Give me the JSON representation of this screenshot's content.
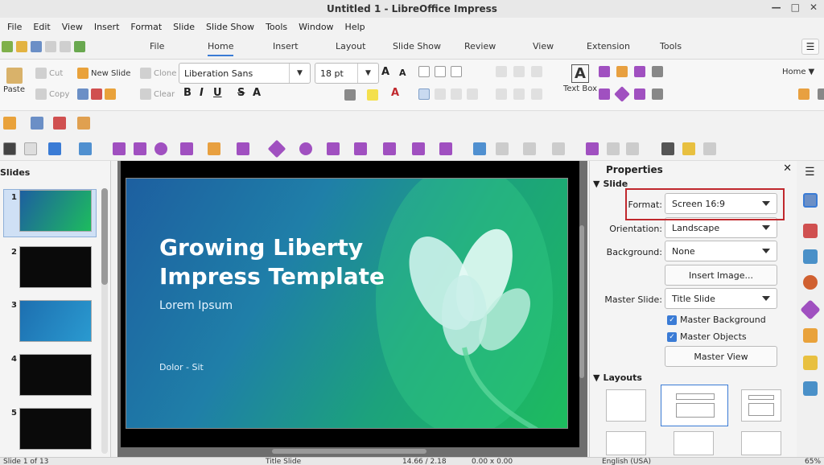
{
  "window": {
    "title": "Untitled 1 - LibreOffice Impress"
  },
  "menu": [
    "File",
    "Edit",
    "View",
    "Insert",
    "Format",
    "Slide",
    "Slide Show",
    "Tools",
    "Window",
    "Help"
  ],
  "tabs": [
    "File",
    "Home",
    "Insert",
    "Layout",
    "Slide Show",
    "Review",
    "View",
    "Extension",
    "Tools"
  ],
  "ribbon": {
    "paste": "Paste",
    "cut": "Cut",
    "copy": "Copy",
    "new_slide": "New Slide",
    "clone": "Clone",
    "clear": "Clear",
    "font_name": "Liberation Sans",
    "font_size": "18 pt",
    "text_box": "Text Box",
    "home_dropdown": "Home"
  },
  "slides_pane": {
    "title": "Slides",
    "numbers": [
      "1",
      "2",
      "3",
      "4",
      "5"
    ]
  },
  "slide": {
    "title": "Growing Liberty Impress Template",
    "subtitle": "Lorem Ipsum",
    "footer": "Dolor - Sit"
  },
  "properties": {
    "title": "Properties",
    "section_slide": "Slide",
    "format_label": "Format:",
    "format_value": "Screen 16:9",
    "orientation_label": "Orientation:",
    "orientation_value": "Landscape",
    "background_label": "Background:",
    "background_value": "None",
    "insert_image": "Insert Image...",
    "master_slide_label": "Master Slide:",
    "master_slide_value": "Title Slide",
    "master_background": "Master Background",
    "master_objects": "Master Objects",
    "master_view": "Master View",
    "section_layouts": "Layouts"
  },
  "status": {
    "slide_pos": "Slide 1 of 13",
    "master": "Title Slide",
    "position": "14.66 / 2.18",
    "size": "0.00 x 0.00",
    "language": "English (USA)",
    "zoom": "65%"
  },
  "colors": {
    "accent": "#3a7bd5",
    "highlight": "#c0282d"
  }
}
